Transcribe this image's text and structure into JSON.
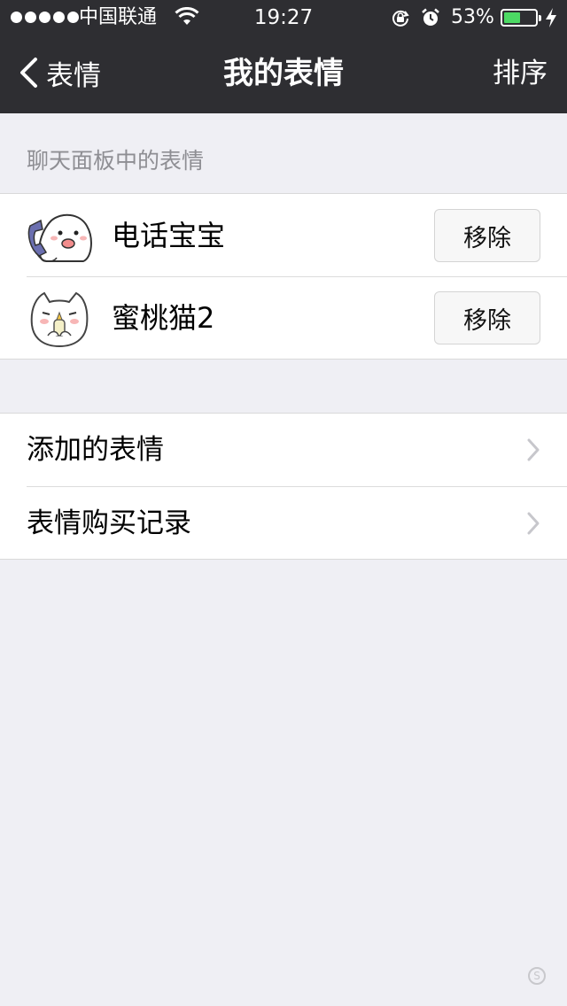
{
  "status_bar": {
    "carrier": "中国联通",
    "time": "19:27",
    "battery_percent": "53%",
    "battery_level": 0.53,
    "icons": [
      "signal-dots-icon",
      "wifi-icon",
      "rotation-lock-icon",
      "alarm-icon",
      "battery-icon",
      "charging-bolt-icon"
    ]
  },
  "nav": {
    "back_label": "表情",
    "title": "我的表情",
    "action_label": "排序"
  },
  "section_title": "聊天面板中的表情",
  "stickers": [
    {
      "name": "电话宝宝",
      "action": "移除",
      "icon": "phone-baby-sticker"
    },
    {
      "name": "蜜桃猫2",
      "action": "移除",
      "icon": "peach-cat-sticker"
    }
  ],
  "menu": [
    {
      "label": "添加的表情"
    },
    {
      "label": "表情购买记录"
    }
  ],
  "colors": {
    "nav_bg": "#2e2e32",
    "page_bg": "#efeff4",
    "battery_fill": "#4cd964"
  }
}
